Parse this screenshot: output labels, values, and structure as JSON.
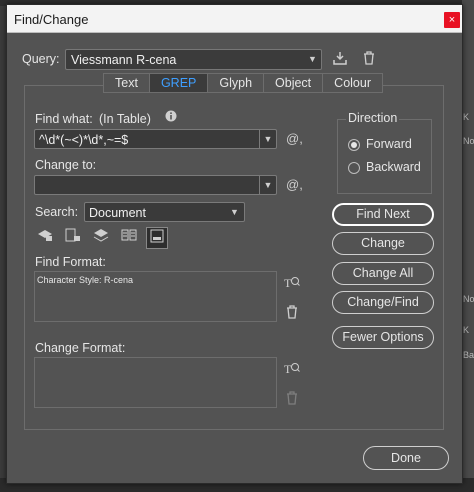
{
  "background": {
    "right_fragments": [
      "K",
      "No",
      "No",
      "K",
      "Ba"
    ]
  },
  "window": {
    "title": "Find/Change",
    "close_label": "×"
  },
  "query": {
    "label": "Query:",
    "value": "Viessmann R-cena",
    "save_icon": "save-query-icon",
    "delete_icon": "trash-icon"
  },
  "tabs": [
    {
      "label": "Text",
      "active": false
    },
    {
      "label": "GREP",
      "active": true
    },
    {
      "label": "Glyph",
      "active": false
    },
    {
      "label": "Object",
      "active": false
    },
    {
      "label": "Colour",
      "active": false
    }
  ],
  "find_what": {
    "label": "Find what:",
    "scope": "(In Table)",
    "info_icon": "info-icon",
    "value": "^\\d*(~<)*\\d*,~=$"
  },
  "change_to": {
    "label": "Change to:",
    "value": ""
  },
  "search": {
    "label": "Search:",
    "value": "Document"
  },
  "tool_icons": [
    "include-locked-layers-icon",
    "include-locked-stories-icon",
    "include-hidden-layers-icon",
    "include-master-pages-icon",
    "include-footnotes-icon"
  ],
  "find_format": {
    "label": "Find Format:",
    "value": "Character Style: R-cena"
  },
  "change_format": {
    "label": "Change Format:",
    "value": ""
  },
  "direction": {
    "label": "Direction",
    "options": [
      {
        "label": "Forward",
        "selected": true
      },
      {
        "label": "Backward",
        "selected": false
      }
    ]
  },
  "buttons": {
    "find_next": "Find Next",
    "change": "Change",
    "change_all": "Change All",
    "change_find": "Change/Find",
    "fewer_options": "Fewer Options",
    "done": "Done"
  },
  "colors": {
    "accent": "#3f9fff",
    "dialog_bg": "#535353",
    "close": "#e81123"
  }
}
